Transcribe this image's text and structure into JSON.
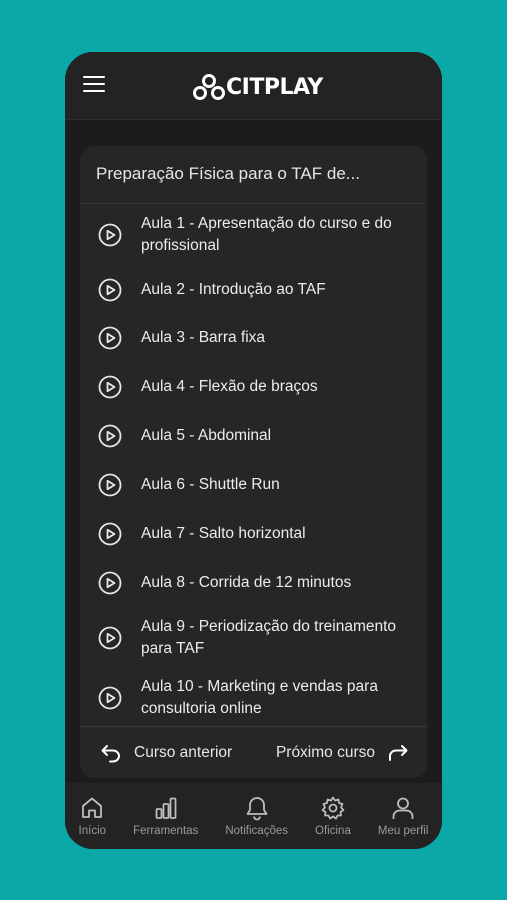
{
  "app": {
    "logo_text": "CITPLAY"
  },
  "course": {
    "title": "Preparação Física para o TAF de..."
  },
  "lessons": [
    {
      "label": "Aula 1 - Apresentação do curso e do profissional"
    },
    {
      "label": "Aula 2 - Introdução ao TAF"
    },
    {
      "label": "Aula 3 - Barra fixa"
    },
    {
      "label": "Aula 4 - Flexão de braços"
    },
    {
      "label": "Aula 5 - Abdominal"
    },
    {
      "label": "Aula 6 - Shuttle Run"
    },
    {
      "label": "Aula 7 - Salto horizontal"
    },
    {
      "label": "Aula 8 - Corrida de 12 minutos"
    },
    {
      "label": "Aula 9 - Periodização do treinamento para TAF"
    },
    {
      "label": "Aula 10 - Marketing e vendas para consultoria online"
    }
  ],
  "course_nav": {
    "prev_label": "Curso anterior",
    "next_label": "Próximo curso"
  },
  "tabs": [
    {
      "label": "Início",
      "icon": "home-icon"
    },
    {
      "label": "Ferramentas",
      "icon": "bar-chart-icon"
    },
    {
      "label": "Notificações",
      "icon": "bell-icon"
    },
    {
      "label": "Oficina",
      "icon": "gear-icon"
    },
    {
      "label": "Meu perfil",
      "icon": "user-icon"
    }
  ],
  "colors": {
    "background": "#0aa9a8",
    "surface": "#1c1c1c",
    "card": "#262626",
    "text": "#ececec",
    "muted": "#9a9a9a"
  }
}
